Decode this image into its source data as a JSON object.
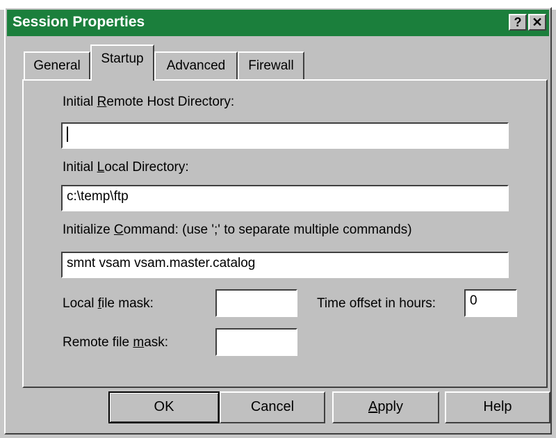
{
  "window": {
    "title": "Session Properties"
  },
  "titlebar_buttons": {
    "help": "?",
    "close": "✕"
  },
  "tabs": [
    {
      "label": "General"
    },
    {
      "label": "Startup"
    },
    {
      "label": "Advanced"
    },
    {
      "label": "Firewall"
    }
  ],
  "active_tab": "Startup",
  "fields": {
    "remote_dir": {
      "label_pre": "Initial ",
      "label_key": "R",
      "label_post": "emote Host Directory:",
      "value": ""
    },
    "local_dir": {
      "label_pre": "Initial ",
      "label_key": "L",
      "label_post": "ocal Directory:",
      "value": "c:\\temp\\ftp"
    },
    "init_cmd": {
      "label_pre": "Initialize ",
      "label_key": "C",
      "label_post": "ommand: (use ';' to separate multiple commands)",
      "value": "smnt vsam vsam.master.catalog"
    },
    "local_mask": {
      "label_pre": "Local ",
      "label_key": "f",
      "label_post": "ile mask:",
      "value": ""
    },
    "time_offset": {
      "label": "Time offset in hours:",
      "value": "0"
    },
    "remote_mask": {
      "label_pre": "Remote file ",
      "label_key": "m",
      "label_post": "ask:",
      "value": ""
    }
  },
  "buttons": {
    "ok": "OK",
    "cancel": "Cancel",
    "apply_pre": "",
    "apply_key": "A",
    "apply_post": "pply",
    "help": "Help"
  },
  "colors": {
    "titlebar": "#1b7f3c",
    "face": "#c0c0c0"
  }
}
